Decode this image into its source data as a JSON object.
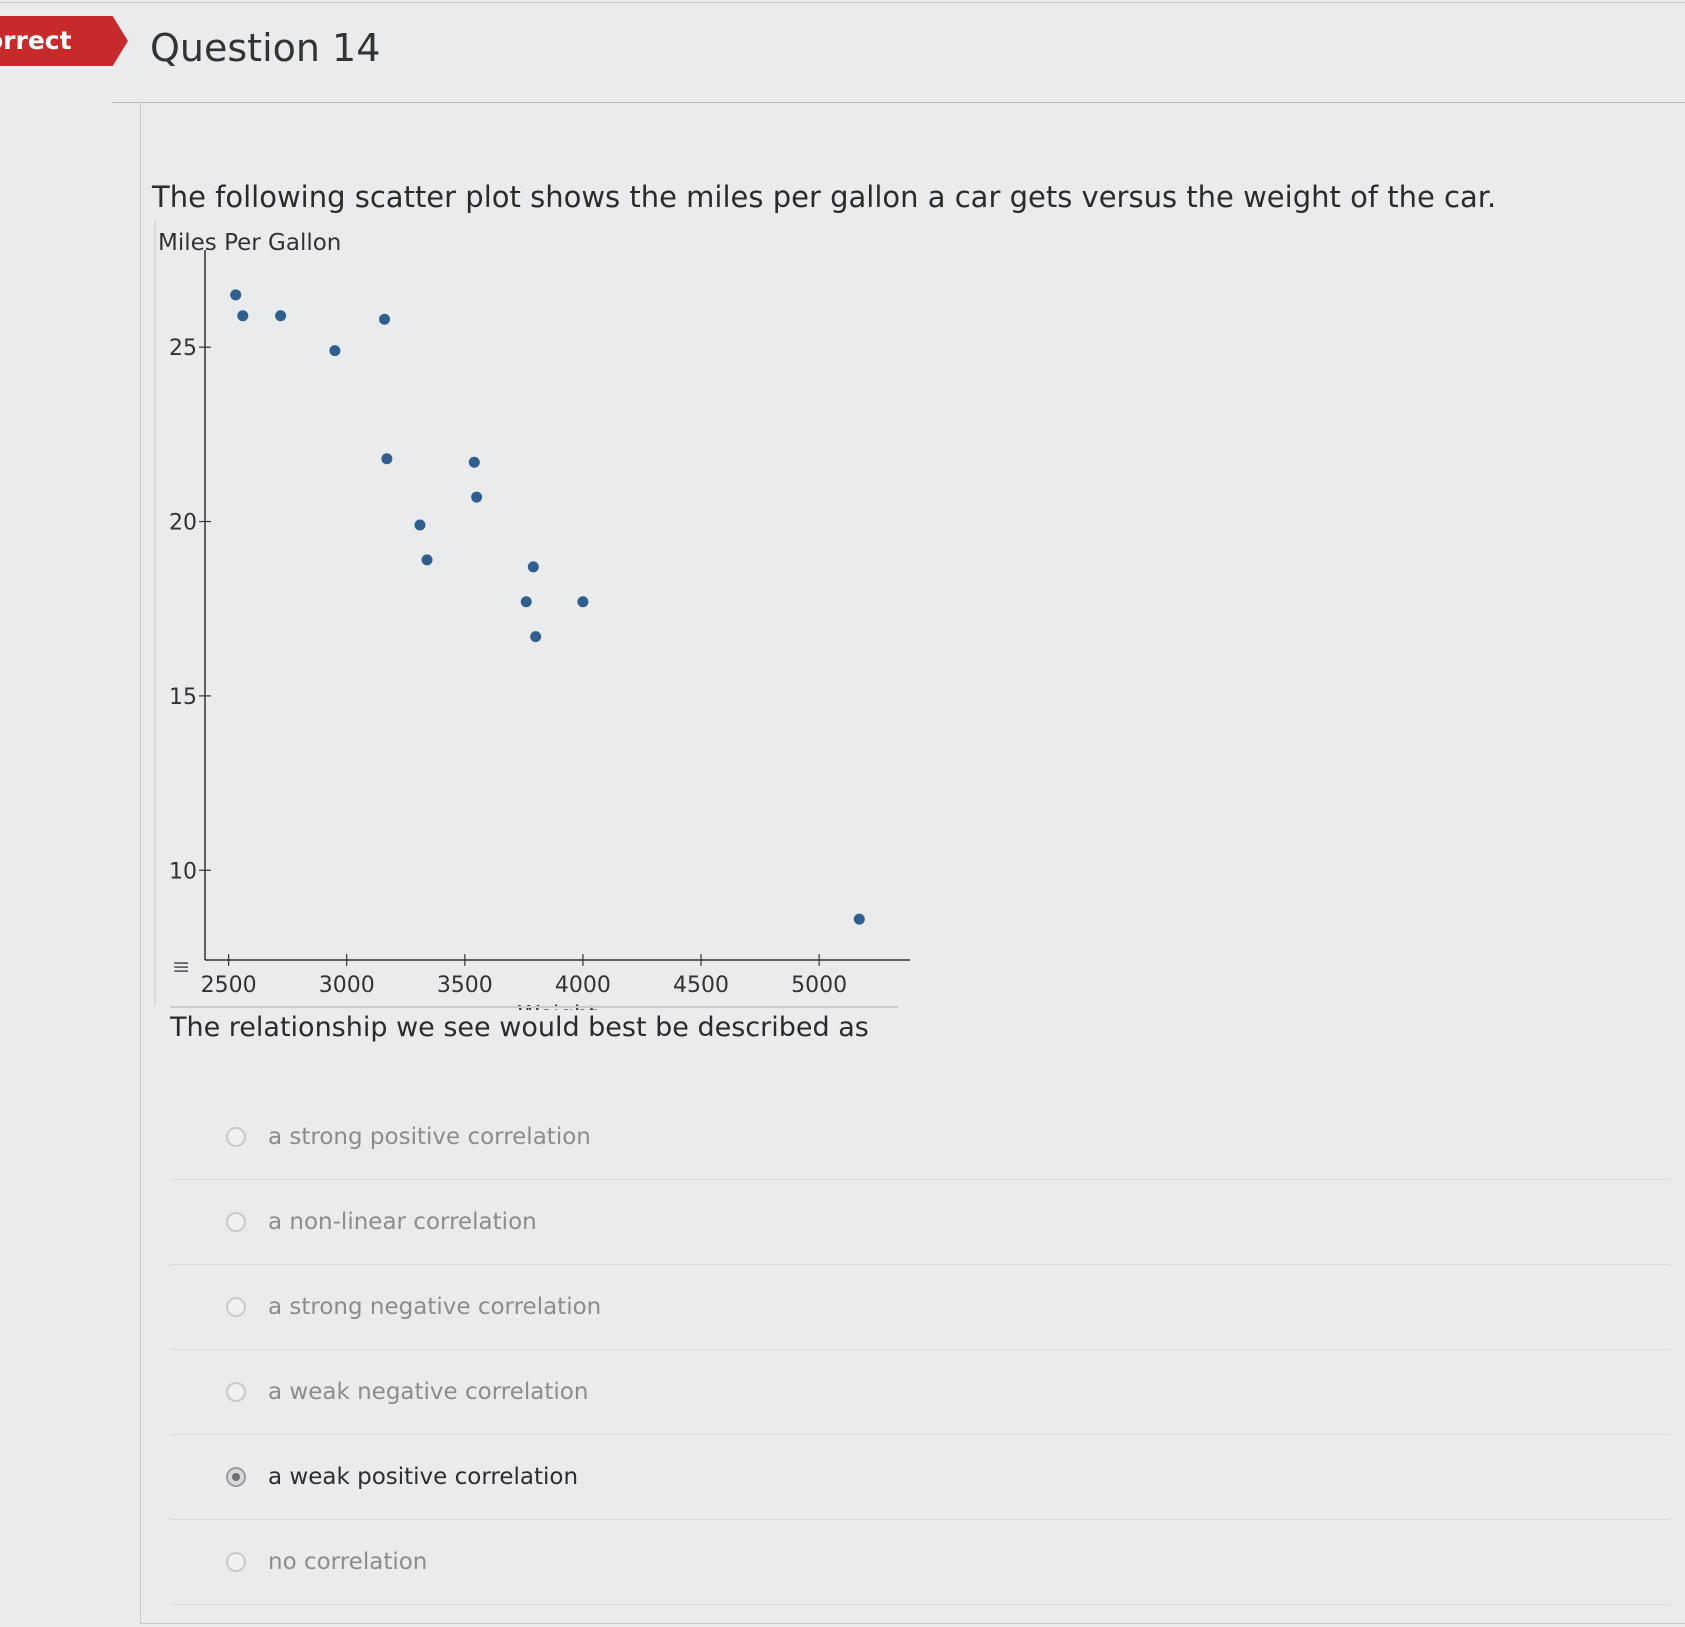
{
  "header": {
    "status_label": "orrect",
    "question_title": "Question 14"
  },
  "prompt": "The following scatter plot shows the miles per gallon a car gets versus the weight of the car.",
  "question_text": "The relationship we see would best be described as",
  "chart_data": {
    "type": "scatter",
    "title": "",
    "xlabel": "Weight",
    "ylabel": "Miles Per Gallon",
    "xlim": [
      2400,
      5300
    ],
    "ylim": [
      8,
      27.5
    ],
    "x_ticks": [
      2500,
      3000,
      3500,
      4000,
      4500,
      5000
    ],
    "y_ticks": [
      10,
      15,
      20,
      25
    ],
    "grid": false,
    "points": [
      {
        "x": 2530,
        "y": 26.5
      },
      {
        "x": 2560,
        "y": 25.9
      },
      {
        "x": 2720,
        "y": 25.9
      },
      {
        "x": 2950,
        "y": 24.9
      },
      {
        "x": 3160,
        "y": 25.8
      },
      {
        "x": 3170,
        "y": 21.8
      },
      {
        "x": 3310,
        "y": 19.9
      },
      {
        "x": 3340,
        "y": 18.9
      },
      {
        "x": 3540,
        "y": 21.7
      },
      {
        "x": 3550,
        "y": 20.7
      },
      {
        "x": 3760,
        "y": 17.7
      },
      {
        "x": 3790,
        "y": 18.7
      },
      {
        "x": 3800,
        "y": 16.7
      },
      {
        "x": 4000,
        "y": 17.7
      },
      {
        "x": 5170,
        "y": 8.6
      }
    ],
    "point_color": "#2f5e8f"
  },
  "options": [
    {
      "label": "a strong positive correlation",
      "selected": false
    },
    {
      "label": "a non-linear correlation",
      "selected": false
    },
    {
      "label": "a strong negative correlation",
      "selected": false
    },
    {
      "label": "a weak negative correlation",
      "selected": false
    },
    {
      "label": "a weak positive correlation",
      "selected": true
    },
    {
      "label": "no correlation",
      "selected": false
    }
  ],
  "colors": {
    "status_tag": "#c62a2a",
    "accent_point": "#2f5e8f"
  },
  "icons": {
    "chart_menu": "menu-lines-icon"
  }
}
